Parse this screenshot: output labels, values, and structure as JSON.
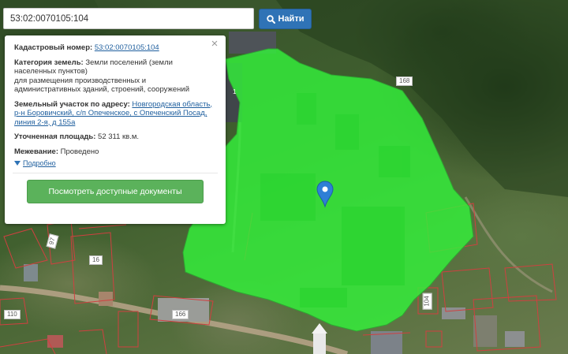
{
  "search": {
    "value": "53:02:0070105:104",
    "button_label": "Найти"
  },
  "popup": {
    "cadastral_label": "Кадастровый номер:",
    "cadastral_value": "53:02:0070105:104",
    "category_label": "Категория земель:",
    "category_line1": "Земли поселений (земли",
    "category_line2": "населенных пунктов)",
    "category_line3": "для размещения производственных и",
    "category_line4": "административных зданий, строений, сооружений",
    "address_label": "Земельный участок по адресу:",
    "address_line1": "Новгородская область,",
    "address_line2": "р-н Боровичский, с/п Опеченское, с Опеченский Посад,",
    "address_line3": "линия 2-я, д 155а",
    "area_label": "Уточненная площадь:",
    "area_value": "52 311 кв.м.",
    "survey_label": "Межевание:",
    "survey_value": "Проведено",
    "details_label": "Подробно",
    "docs_button_label": "Посмотреть доступные документы"
  },
  "map_labels": {
    "plot_168": "168",
    "plot_16": "16",
    "plot_97": "97",
    "plot_110": "110",
    "plot_166": "166",
    "plot_104": "104",
    "plot_1": "1"
  },
  "colors": {
    "parcel_fill": "#33f23a",
    "parcel_border": "#2fa832",
    "boundary_lines": "#d04040",
    "marker": "#2f7fd6",
    "button_blue": "#2f73b6",
    "button_green": "#5bb25b"
  },
  "icons": {
    "search_button_icon": "search-icon",
    "close_icon": "close-icon",
    "details_icon": "triangle-down-icon",
    "marker_icon": "map-pin-icon"
  }
}
